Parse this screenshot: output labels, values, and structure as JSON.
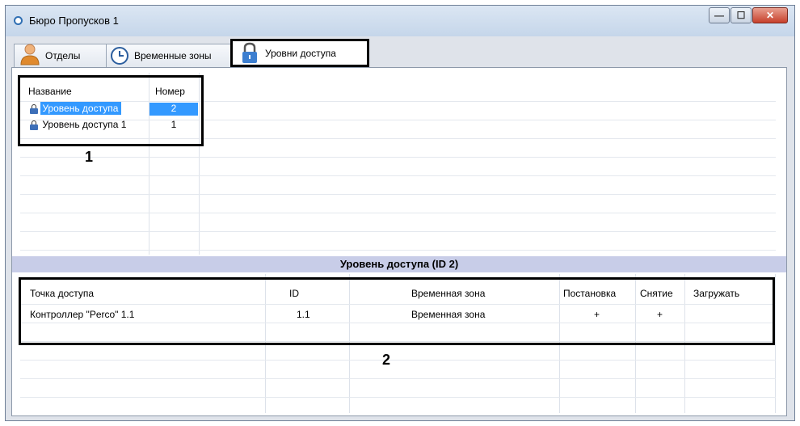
{
  "window": {
    "title": "Бюро Пропусков 1",
    "min_glyph": "—",
    "max_glyph": "☐",
    "close_glyph": "✕"
  },
  "tabs": [
    {
      "label": "Отделы",
      "icon": "user-icon"
    },
    {
      "label": "Временные зоны",
      "icon": "clock-icon"
    },
    {
      "label": "Уровни доступа",
      "icon": "lock-icon",
      "active": true
    }
  ],
  "levels_table": {
    "columns": [
      "Название",
      "Номер"
    ],
    "rows": [
      {
        "name": "Уровень доступа",
        "number": "2",
        "selected": true
      },
      {
        "name": "Уровень доступа 1",
        "number": "1",
        "selected": false
      }
    ]
  },
  "detail": {
    "section_title": "Уровень доступа (ID 2)",
    "columns": [
      "Точка доступа",
      "ID",
      "Временная зона",
      "Постановка",
      "Снятие",
      "Загружать"
    ],
    "rows": [
      {
        "point": "Контроллер \"Perco\" 1.1",
        "id": "1.1",
        "zone": "Временная зона",
        "arm": "+",
        "disarm": "+",
        "load": ""
      }
    ]
  },
  "annotations": {
    "label_1": "1",
    "label_2": "2"
  },
  "colors": {
    "selection": "#3399ff",
    "section_header": "#c8cde8",
    "lock": "#3d6fb8"
  }
}
